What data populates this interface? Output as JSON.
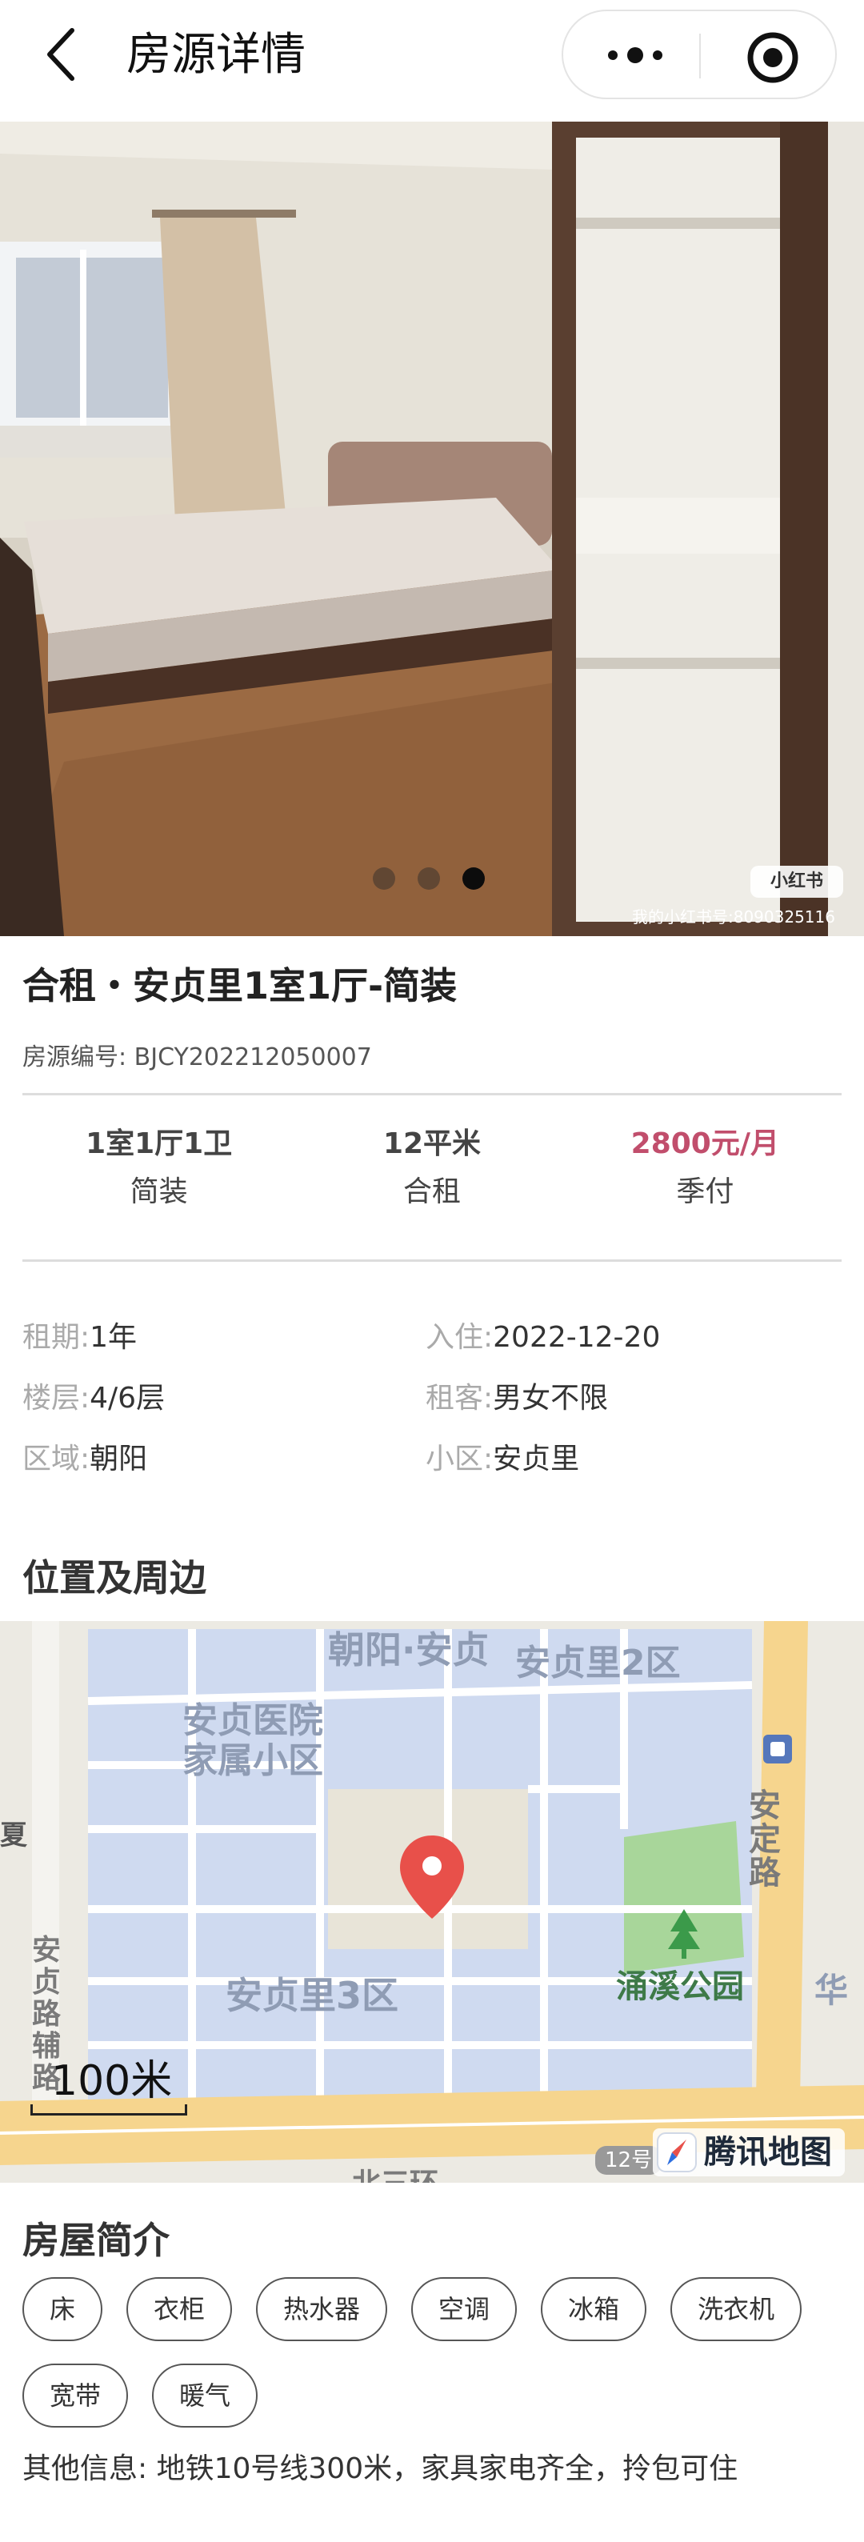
{
  "header": {
    "title": "房源详情",
    "back_icon": "chevron-left-icon",
    "more_icon": "more-dots-icon",
    "close_icon": "target-circle-icon"
  },
  "gallery": {
    "image_count": 3,
    "active_index": 2,
    "watermark_logo": "小红书",
    "watermark_text": "我的小红书号:8090325116"
  },
  "house": {
    "title": "合租・安贞里1室1厅-简装",
    "code": "房源编号: BJCY202212050007"
  },
  "stats": [
    {
      "top": "1室1厅1卫",
      "bottom": "简装"
    },
    {
      "top": "12平米",
      "bottom": "合租"
    },
    {
      "top": "2800元/月",
      "bottom": "季付"
    }
  ],
  "info": [
    {
      "k1": "租期:",
      "v1": "1年",
      "k2": "入住:",
      "v2": "2022-12-20"
    },
    {
      "k1": "楼层:",
      "v1": "4/6层",
      "k2": "租客:",
      "v2": "男女不限"
    },
    {
      "k1": "区域:",
      "v1": "朝阳",
      "k2": "小区:",
      "v2": "安贞里"
    }
  ],
  "location": {
    "section_title": "位置及周边",
    "labels": {
      "l1": "朝阳·安贞",
      "l2": "安贞里2区",
      "l3": "安贞医院",
      "l4": "家属小区",
      "l5": "安定路",
      "l6": "涌溪公园",
      "l7": "安贞里3区",
      "l8": "安贞路辅路",
      "l9": "北三环",
      "l10": "华",
      "l11": "夏"
    },
    "scale": "100米",
    "road_badge": "12号",
    "provider": "腾讯地图"
  },
  "intro": {
    "section_title": "房屋简介",
    "tags": [
      "床",
      "衣柜",
      "热水器",
      "空调",
      "冰箱",
      "洗衣机",
      "宽带",
      "暖气"
    ],
    "other": "其他信息: 地铁10号线300米，家具家电齐全，拎包可住"
  },
  "colors": {
    "price": "#c14e6c",
    "map_block": "#cfdaf0",
    "map_road": "#ffffff",
    "main_road": "#f6d58e",
    "marker": "#e8504a"
  }
}
